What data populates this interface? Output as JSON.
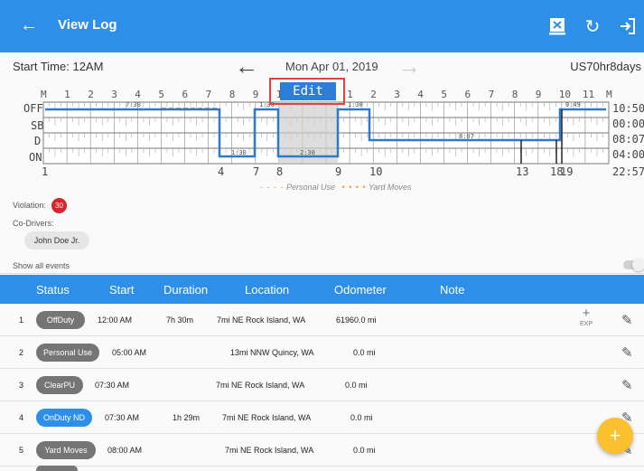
{
  "header": {
    "title": "View Log",
    "back_icon": "arrow-left-icon",
    "actions": [
      "document-cancel-icon",
      "refresh-icon",
      "logout-icon"
    ],
    "color": "#2d8fe8"
  },
  "subheader": {
    "start_time": "Start Time: 12AM",
    "date": "Mon Apr 01, 2019",
    "cycle": "US70hr8days"
  },
  "graph": {
    "hours_top": [
      "M",
      "1",
      "2",
      "3",
      "4",
      "5",
      "6",
      "7",
      "8",
      "9",
      "10",
      "11",
      "N",
      "1",
      "2",
      "3",
      "4",
      "5",
      "6",
      "7",
      "8",
      "9",
      "10",
      "11",
      "M"
    ],
    "row_labels": [
      "OFF",
      "SB",
      "D",
      "ON"
    ],
    "totals": [
      "10:50",
      "00:00",
      "08:07",
      "04:00",
      "22:57"
    ],
    "bottom_ticks": [
      "1",
      "4",
      "7",
      "8",
      "9",
      "10",
      "13",
      "18",
      "19"
    ],
    "segment_labels": [
      "7:30",
      "1:30",
      "1:30",
      "2:30",
      "1:30",
      "8:07",
      "0:49"
    ],
    "edit_label": "Edit",
    "legend": {
      "personal_use": "Personal Use",
      "yard_moves": "Yard Moves",
      "dashes": "- - - -",
      "dots": "• • • •"
    }
  },
  "violation": {
    "label": "Violation:",
    "count": "30"
  },
  "codrivers": {
    "label": "Co-Drivers:",
    "names": [
      "John Doe Jr."
    ]
  },
  "show_all_events": "Show all events",
  "table": {
    "headers": [
      "Status",
      "Start",
      "Duration",
      "Location",
      "Odometer",
      "Note"
    ],
    "rows": [
      {
        "num": "1",
        "status": "OffDuty",
        "start": "12:00 AM",
        "duration": "7h 30m",
        "location": "7mi NE Rock Island, WA",
        "odometer": "61960.0 mi",
        "exp": "EXP",
        "color": "#757575"
      },
      {
        "num": "2",
        "status": "Personal Use",
        "start": "05:00 AM",
        "duration": "",
        "location": "13mi NNW Quincy, WA",
        "odometer": "0.0 mi",
        "color": "#757575"
      },
      {
        "num": "3",
        "status": "ClearPU",
        "start": "07:30 AM",
        "duration": "",
        "location": "7mi NE Rock Island, WA",
        "odometer": "0.0 mi",
        "color": "#757575"
      },
      {
        "num": "4",
        "status": "OnDuty ND",
        "start": "07:30 AM",
        "duration": "1h 29m",
        "location": "7mi NE Rock Island, WA",
        "odometer": "0.0 mi",
        "color": "#2d8fe8"
      },
      {
        "num": "5",
        "status": "Yard Moves",
        "start": "08:00 AM",
        "duration": "",
        "location": "7mi NE Rock Island, WA",
        "odometer": "0.0 mi",
        "color": "#757575"
      }
    ]
  },
  "fab_label": "+"
}
